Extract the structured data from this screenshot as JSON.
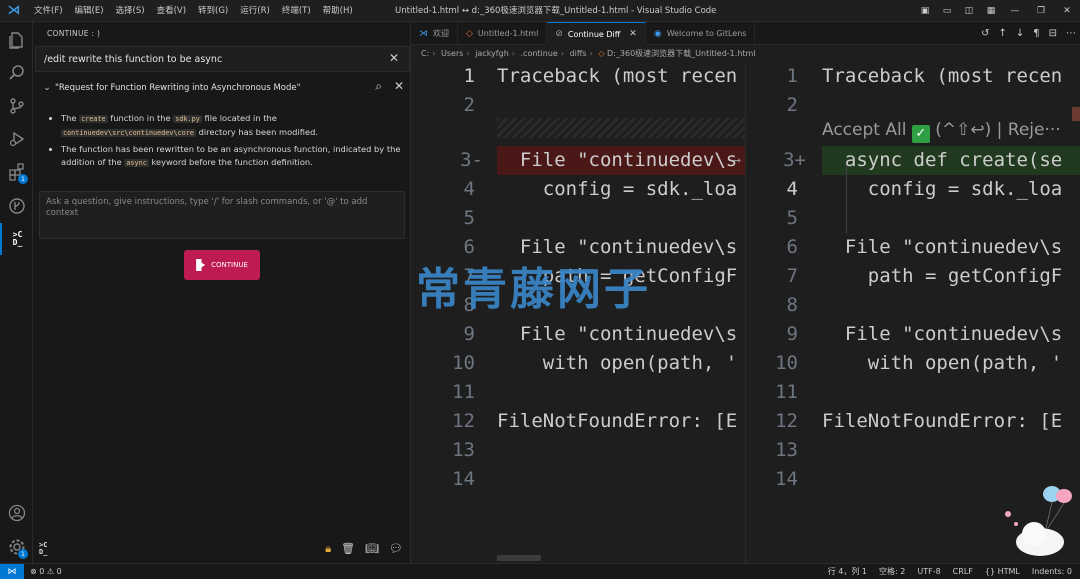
{
  "titlebar": {
    "menu": [
      "文件(F)",
      "编辑(E)",
      "选择(S)",
      "查看(V)",
      "转到(G)",
      "运行(R)",
      "终端(T)",
      "帮助(H)"
    ],
    "window_title": "Untitled-1.html ↔ d:_360极速浏览器下载_Untitled-1.html - Visual Studio Code"
  },
  "activity": {
    "extensions_badge": "1",
    "settings_badge": "1"
  },
  "sidebar": {
    "header": "CONTINUE : )",
    "command": "/edit rewrite this function to be async",
    "section_title": "\"Request for Function Rewriting into Asynchronous Mode\"",
    "bullet1": {
      "a": "The ",
      "code1": "create",
      "b": " function in the ",
      "code2": "sdk.py",
      "c": " file located in the ",
      "code3": "continuedev\\src\\continuedev\\core",
      "d": " directory has been modified."
    },
    "bullet2": {
      "a": "The function has been rewritten to be an asynchronous function, indicated by the addition of the ",
      "code1": "async",
      "b": " keyword before the function definition."
    },
    "ask_placeholder": "Ask a question, give instructions, type '/' for slash commands, or '@' to add context",
    "continue_label": "CONTINUE",
    "footer_logo": ">C\nD_"
  },
  "tabs": [
    {
      "label": "欢迎",
      "icon": "vscode-icon"
    },
    {
      "label": "Untitled-1.html",
      "icon": "file-icon"
    },
    {
      "label": "Continue Diff",
      "icon": "diff-icon"
    },
    {
      "label": "Welcome to GitLens",
      "icon": "gitlens-icon"
    }
  ],
  "breadcrumb": [
    "C:",
    "Users",
    "jackyfgh",
    ".continue",
    "diffs",
    "D:_360极速浏览器下载_Untitled-1.html"
  ],
  "left_pane": {
    "lines": [
      {
        "n": "1",
        "t": "Traceback (most recen"
      },
      {
        "n": "2",
        "t": ""
      },
      {
        "n": "3-",
        "t": "  File \"continuedev\\s"
      },
      {
        "n": "4",
        "t": "    config = sdk._loa"
      },
      {
        "n": "5",
        "t": ""
      },
      {
        "n": "6",
        "t": "  File \"continuedev\\s"
      },
      {
        "n": "7",
        "t": "    path = getConfigF"
      },
      {
        "n": "8",
        "t": ""
      },
      {
        "n": "9",
        "t": "  File \"continuedev\\s"
      },
      {
        "n": "10",
        "t": "    with open(path, '"
      },
      {
        "n": "11",
        "t": ""
      },
      {
        "n": "12",
        "t": "FileNotFoundError: [E"
      },
      {
        "n": "13",
        "t": ""
      },
      {
        "n": "14",
        "t": ""
      }
    ]
  },
  "right_pane": {
    "lens": "Accept All",
    "lens_rest": " (^⇧↩) | Reje···",
    "lines": [
      {
        "n": "1",
        "t": "Traceback (most recen"
      },
      {
        "n": "2",
        "t": ""
      },
      {
        "n": "3+",
        "t": "  async def create(se"
      },
      {
        "n": "4",
        "t": "    config = sdk._loa"
      },
      {
        "n": "5",
        "t": ""
      },
      {
        "n": "6",
        "t": "  File \"continuedev\\s"
      },
      {
        "n": "7",
        "t": "    path = getConfigF"
      },
      {
        "n": "8",
        "t": ""
      },
      {
        "n": "9",
        "t": "  File \"continuedev\\s"
      },
      {
        "n": "10",
        "t": "    with open(path, '"
      },
      {
        "n": "11",
        "t": ""
      },
      {
        "n": "12",
        "t": "FileNotFoundError: [E"
      },
      {
        "n": "13",
        "t": ""
      },
      {
        "n": "14",
        "t": ""
      }
    ]
  },
  "watermark": "常青藤网子",
  "status": {
    "errors": "⊗ 0 ⚠ 0",
    "position": "行 4，列 1",
    "spaces": "空格: 2",
    "encoding": "UTF-8",
    "eol": "CRLF",
    "language": "{} HTML",
    "indents": "Indents: 0"
  }
}
